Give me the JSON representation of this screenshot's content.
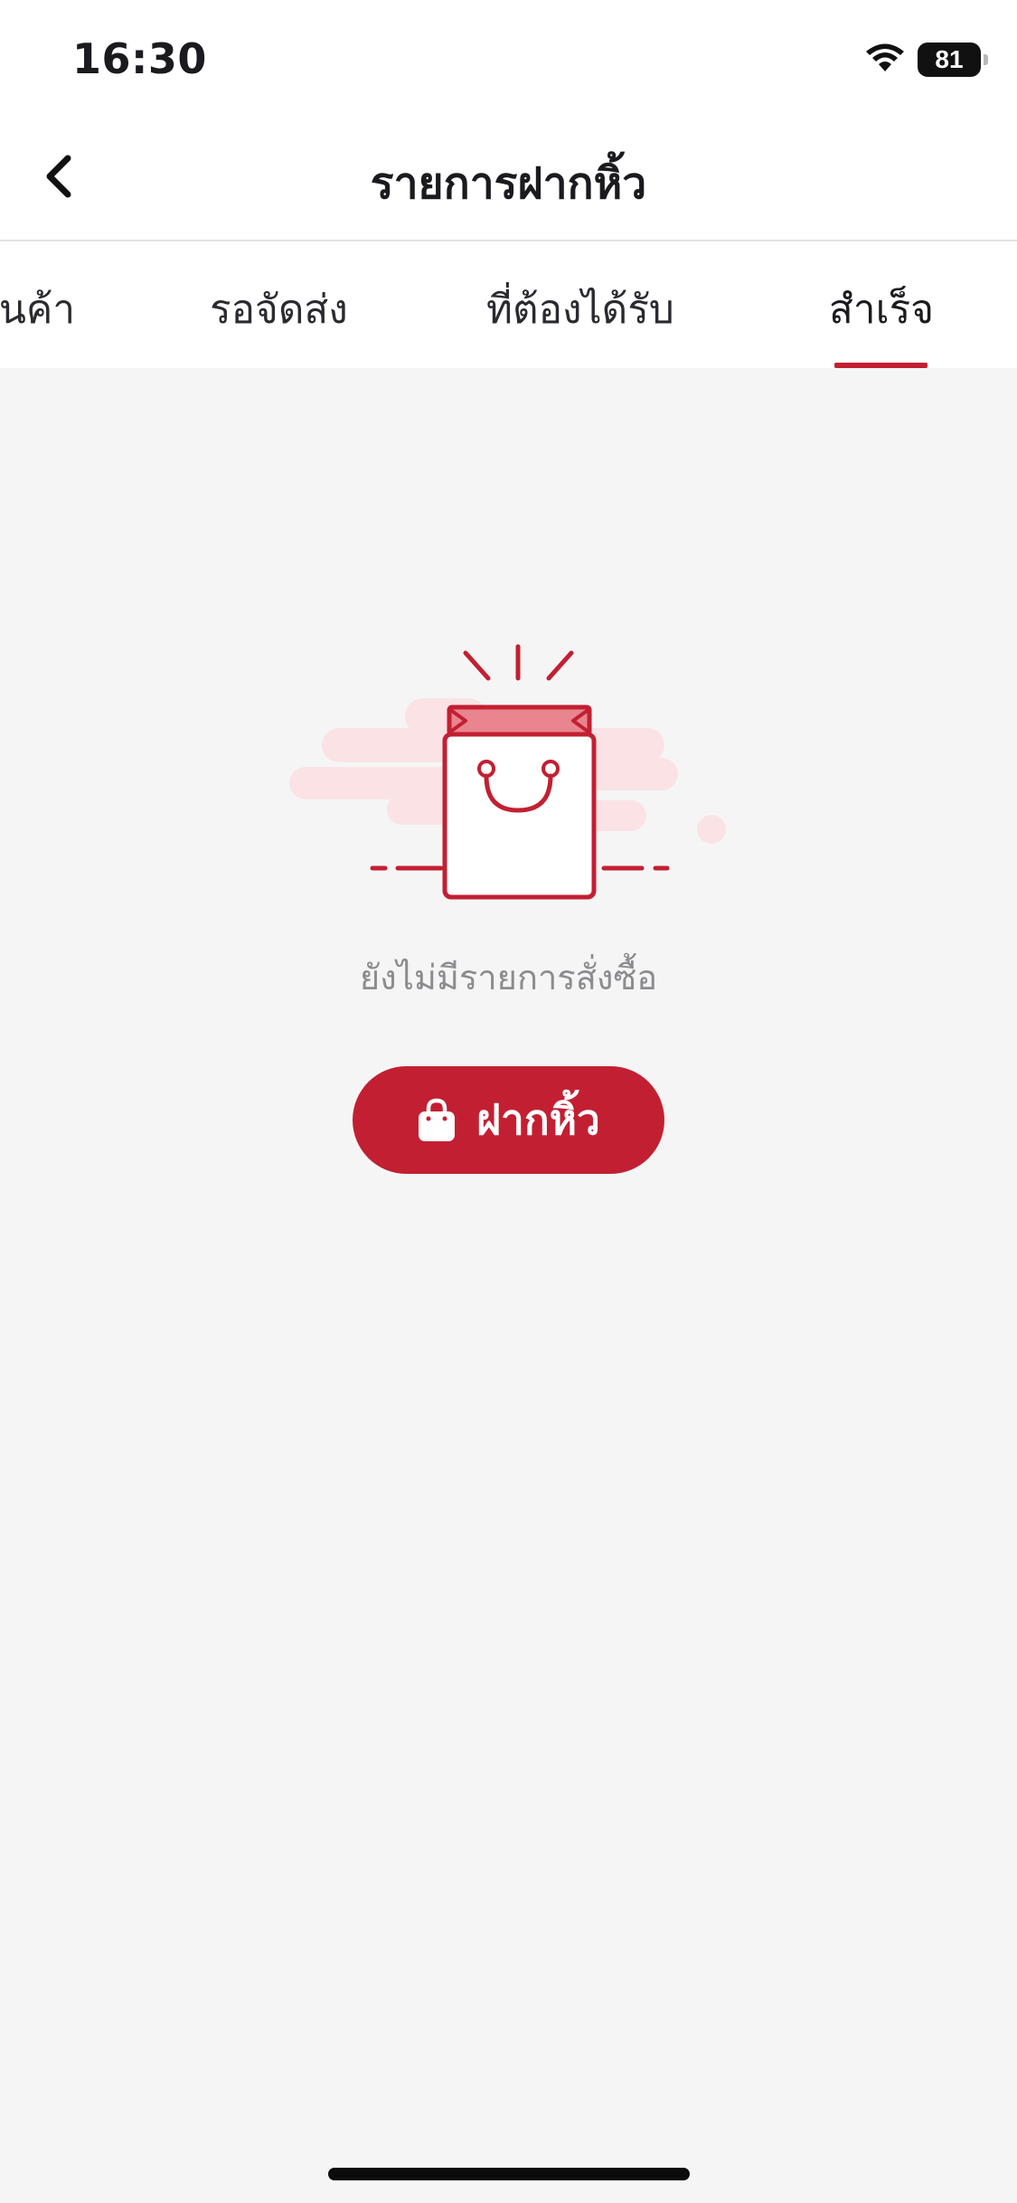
{
  "status_bar": {
    "time": "16:30",
    "battery_level": "81",
    "wifi_icon": "wifi-icon"
  },
  "header": {
    "title": "รายการฝากหิ้ว",
    "back_icon": "chevron-left-icon"
  },
  "tabs": [
    {
      "label": "สินค้า",
      "active": false
    },
    {
      "label": "รอจัดส่ง",
      "active": false
    },
    {
      "label": "ที่ต้องได้รับ",
      "active": false
    },
    {
      "label": "สำเร็จ",
      "active": true
    }
  ],
  "empty_state": {
    "illustration": "shopping-bag-illustration",
    "message": "ยังไม่มีรายการสั่งซื้อ"
  },
  "order_button": {
    "label": "ฝากหิ้ว",
    "icon": "shopping-bag-icon"
  },
  "colors": {
    "accent": "#c31f32",
    "background": "#f5f5f5",
    "illustration_cloud": "#fbe3e5",
    "illustration_fill": "#e8858f"
  }
}
